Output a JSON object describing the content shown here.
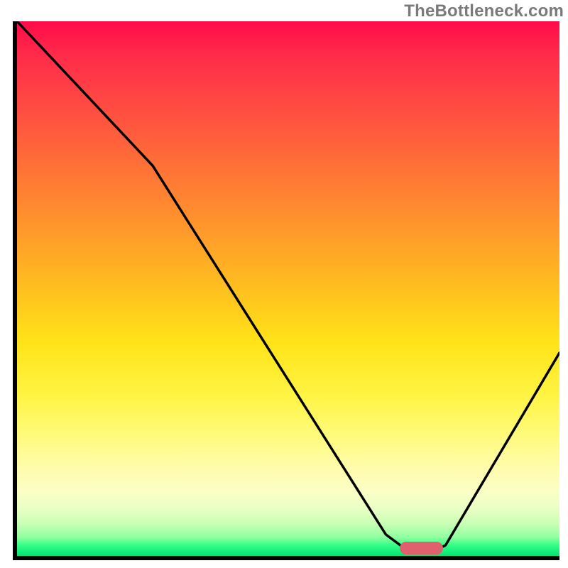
{
  "watermark_text": "TheBottleneck.com",
  "chart_data": {
    "type": "line",
    "title": "",
    "xlabel": "",
    "ylabel": "",
    "xlim": [
      0,
      100
    ],
    "ylim": [
      0,
      100
    ],
    "grid": false,
    "series": [
      {
        "name": "curve",
        "x": [
          0,
          25,
          68,
          72,
          77,
          79,
          100
        ],
        "values": [
          100,
          73,
          4,
          1,
          1,
          2,
          38
        ]
      }
    ],
    "marker": {
      "x_center": 74.5,
      "width": 8,
      "y": 1.5,
      "color": "#e0616e"
    },
    "background_gradient": [
      "#ff0a4a",
      "#ffbf1f",
      "#fff443",
      "#00e472"
    ]
  }
}
